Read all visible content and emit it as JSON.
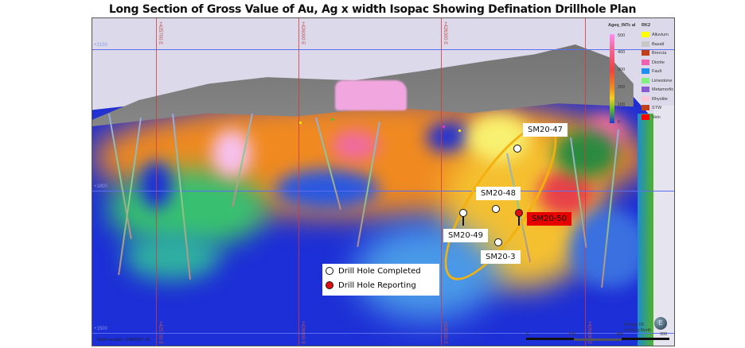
{
  "title": "Long Section of Gross Value of Au, Ag x width Isopac Showing Defination Drillhole Plan",
  "grid": {
    "eastings": [
      "+425700 E",
      "+426000 E",
      "+426300 E",
      "+426600 E"
    ],
    "elevations": [
      "+2100",
      "+1800",
      "+1500"
    ],
    "section_label": "North section +2960067.43"
  },
  "color_legend": {
    "title": "Ageq_INTc al",
    "ticks": [
      "500",
      "400",
      "300",
      "200",
      "100",
      "0"
    ]
  },
  "rock_legend": {
    "title": "RK2",
    "items": [
      {
        "label": "Alluvium",
        "color": "#ffff00"
      },
      {
        "label": "Basalt",
        "color": "#c8c8c8"
      },
      {
        "label": "Breccia",
        "color": "#c0401a"
      },
      {
        "label": "Diorite",
        "color": "#f060b0"
      },
      {
        "label": "Fault",
        "color": "#1e8ff0"
      },
      {
        "label": "Limestone",
        "color": "#80f080"
      },
      {
        "label": "Metamorfic",
        "color": "#8a5ad0"
      },
      {
        "label": "Rhyolite",
        "color": "#ffc8d8"
      },
      {
        "label": "STW",
        "color": "#c0401a"
      },
      {
        "label": "Vein",
        "color": "#ff0000"
      }
    ]
  },
  "drillholes": [
    {
      "id": "SM20-47",
      "status": "completed"
    },
    {
      "id": "SM20-48",
      "status": "completed"
    },
    {
      "id": "SM20-49",
      "status": "completed"
    },
    {
      "id": "SM20-50",
      "status": "reporting"
    },
    {
      "id": "SM20-3",
      "status": "completed"
    }
  ],
  "legend": {
    "completed": "Drill Hole Completed",
    "reporting": "Drill Hole Reporting"
  },
  "scale": {
    "ticks": [
      "0",
      "100",
      "200",
      "300"
    ]
  },
  "view": {
    "plunge": "Plunge 00",
    "looking": "Looking North",
    "compass": "E"
  },
  "colors": {
    "ellipse": "#f2b10f",
    "reporting": "#e01010"
  }
}
